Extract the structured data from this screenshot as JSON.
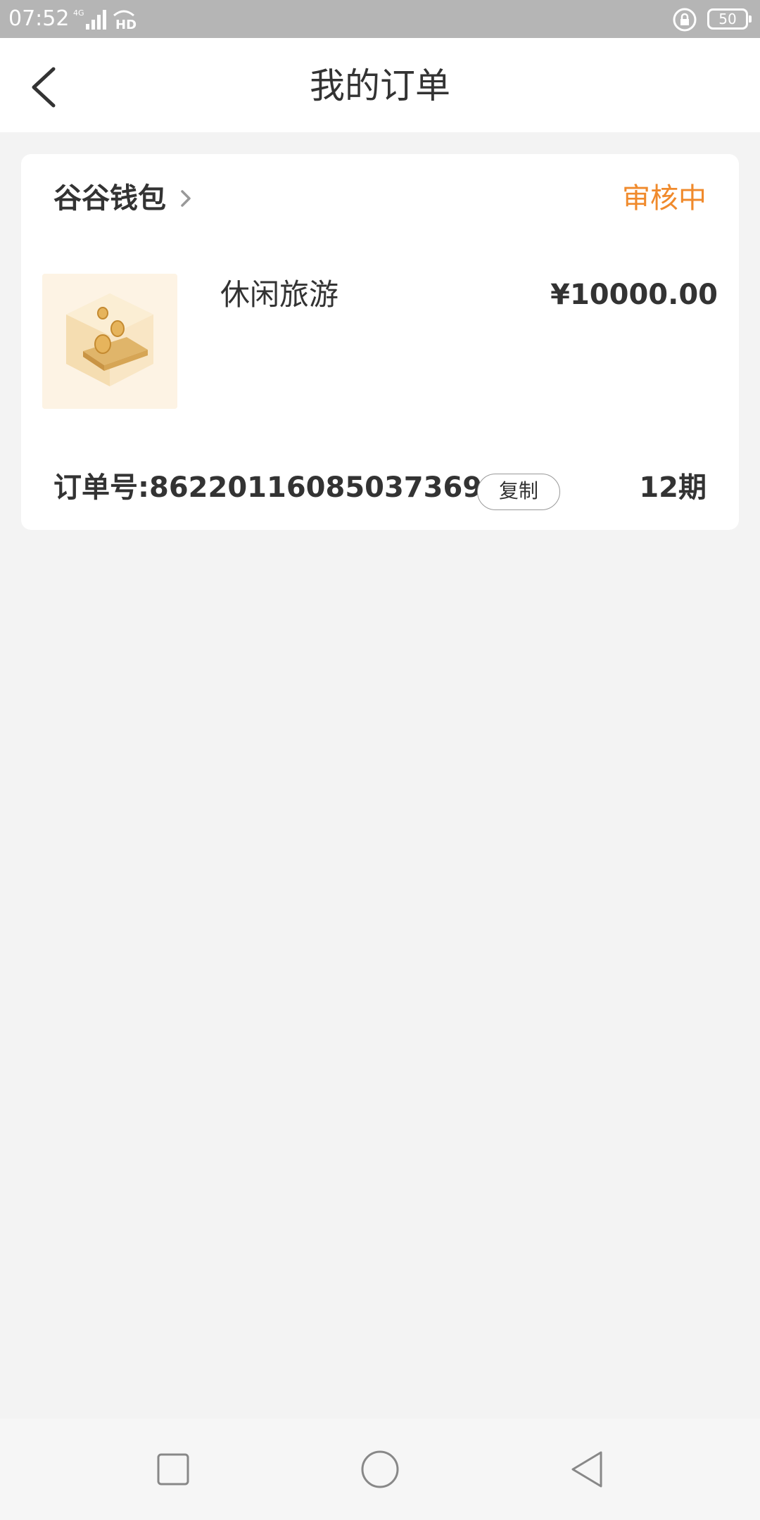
{
  "status_bar": {
    "time": "07:52",
    "network": "4G",
    "hd": "HD",
    "battery": "50"
  },
  "header": {
    "title": "我的订单"
  },
  "order": {
    "merchant": "谷谷钱包",
    "status": "审核中",
    "product_name": "休闲旅游",
    "price": "¥10000.00",
    "order_number_label": "订单号:8622011608503736​92",
    "copy_label": "复制",
    "period": "12期"
  },
  "colors": {
    "accent": "#f08a2c",
    "background": "#f3f3f3",
    "status_bar": "#b5b5b5"
  },
  "nav_bar": {
    "icons": [
      "square-recents-icon",
      "circle-home-icon",
      "triangle-back-icon"
    ]
  }
}
